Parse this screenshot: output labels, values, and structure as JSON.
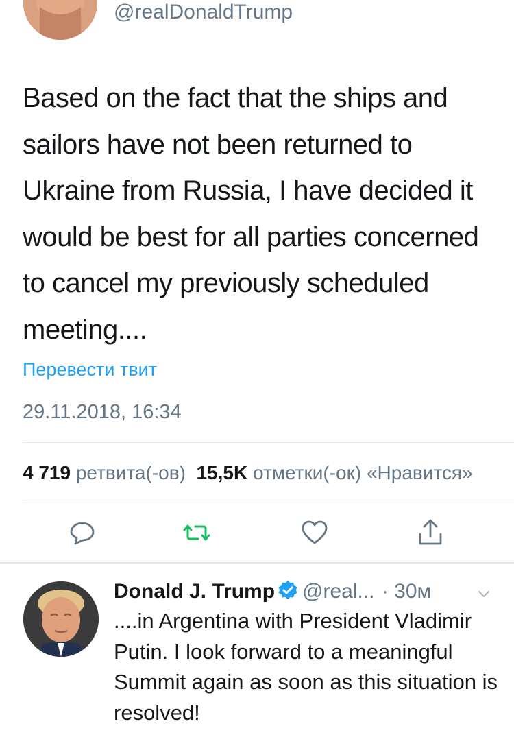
{
  "main_tweet": {
    "handle": "@realDonaldTrump",
    "text": "Based on the fact that the ships and sailors have not been returned to Ukraine from Russia, I have decided it would be best for all parties concerned to cancel my previously scheduled meeting....",
    "translate_label": "Перевести твит",
    "timestamp": "29.11.2018, 16:34",
    "stats": {
      "retweets_count": "4 719",
      "retweets_label": "ретвита(-ов)",
      "likes_count": "15,5K",
      "likes_label": "отметки(-ок) «Нравится»"
    },
    "actions": {
      "reply_icon": "comment-icon",
      "retweet_icon": "retweet-icon",
      "like_icon": "heart-icon",
      "share_icon": "share-icon",
      "retweet_color": "#17bf63",
      "icon_color": "#657786"
    }
  },
  "reply_tweet": {
    "name": "Donald J. Trump",
    "verified_icon": "verified-badge-icon",
    "handle": "@real...",
    "time": "· 30м",
    "menu_icon": "chevron-down-icon",
    "text": "....in Argentina with President Vladimir Putin. I look forward to a meaningful Summit again as soon as this situation is resolved!"
  },
  "colors": {
    "link": "#1da1f2",
    "verified": "#1da1f2",
    "secondary_text": "#657786",
    "divider": "#e1e8ed"
  }
}
